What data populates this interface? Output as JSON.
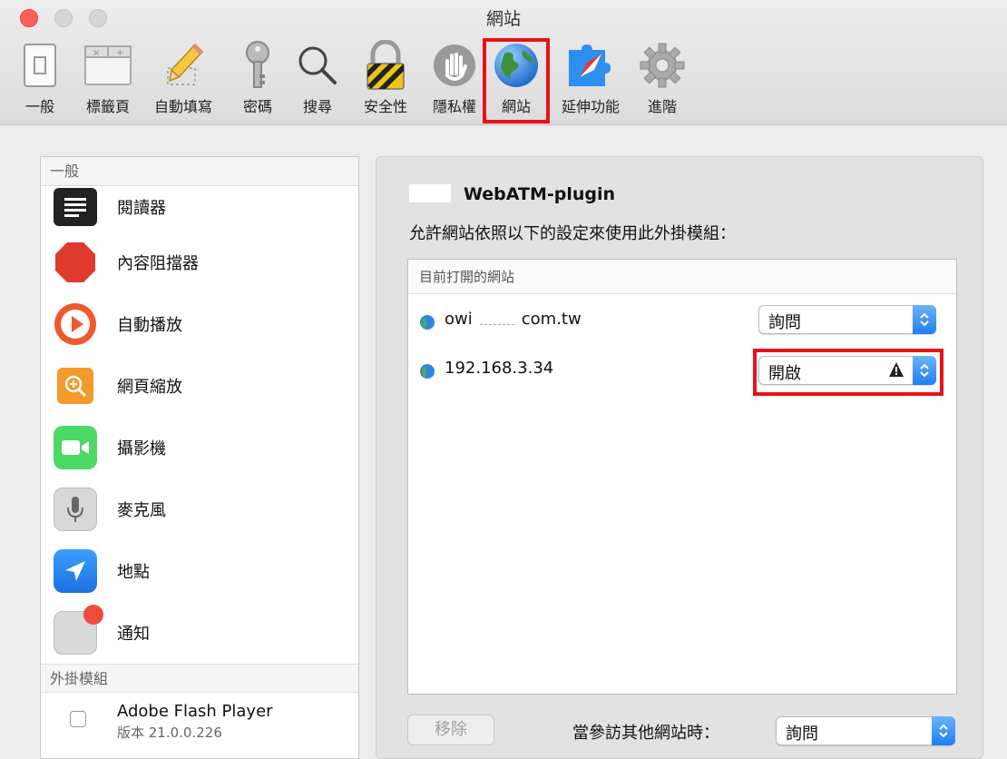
{
  "window": {
    "title": "網站"
  },
  "toolbar": {
    "items": [
      {
        "label": "一般"
      },
      {
        "label": "標籤頁"
      },
      {
        "label": "自動填寫"
      },
      {
        "label": "密碼"
      },
      {
        "label": "搜尋"
      },
      {
        "label": "安全性"
      },
      {
        "label": "隱私權"
      },
      {
        "label": "網站",
        "selected": true
      },
      {
        "label": "延伸功能"
      },
      {
        "label": "進階"
      }
    ]
  },
  "sidebar": {
    "general_header": "一般",
    "items": [
      {
        "label": "閱讀器",
        "icon": "reader-icon"
      },
      {
        "label": "內容阻擋器",
        "icon": "stop-icon"
      },
      {
        "label": "自動播放",
        "icon": "play-icon"
      },
      {
        "label": "網頁縮放",
        "icon": "zoom-icon"
      },
      {
        "label": "攝影機",
        "icon": "camera-icon"
      },
      {
        "label": "麥克風",
        "icon": "microphone-icon"
      },
      {
        "label": "地點",
        "icon": "location-icon"
      },
      {
        "label": "通知",
        "icon": "notification-icon"
      }
    ],
    "plugins_header": "外掛模組",
    "plugin": {
      "name": "Adobe Flash Player",
      "version": "版本 21.0.0.226"
    }
  },
  "panel": {
    "title": "WebATM-plugin",
    "description": "允許網站依照以下的設定來使用此外掛模組：",
    "sites_header": "目前打開的網站",
    "sites": [
      {
        "name_start": "owi",
        "name_end": "com.tw",
        "setting": "詢問"
      },
      {
        "name": "192.168.3.34",
        "setting": "開啟",
        "warning": true
      }
    ],
    "remove_label": "移除",
    "other_sites_label": "當參訪其他網站時：",
    "other_sites_value": "詢問"
  },
  "colors": {
    "highlight": "#e8121a",
    "accent": "#1f7ff0"
  }
}
